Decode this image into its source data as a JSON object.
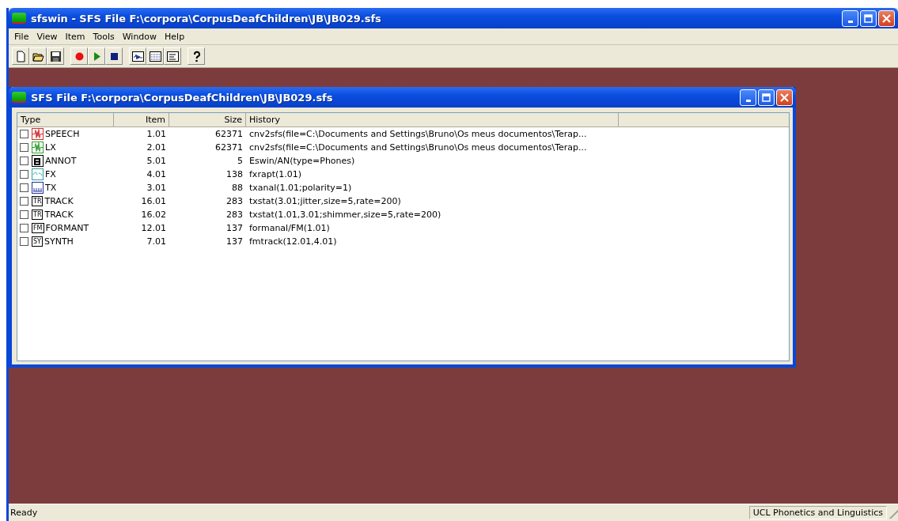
{
  "window": {
    "title": "sfswin - SFS File F:\\corpora\\CorpusDeafChildren\\JB\\JB029.sfs"
  },
  "menu": [
    "File",
    "View",
    "Item",
    "Tools",
    "Window",
    "Help"
  ],
  "toolbar": [
    {
      "kind": "new"
    },
    {
      "kind": "open"
    },
    {
      "kind": "save"
    },
    {
      "kind": "sep"
    },
    {
      "kind": "record"
    },
    {
      "kind": "play"
    },
    {
      "kind": "stop"
    },
    {
      "kind": "sep"
    },
    {
      "kind": "wave"
    },
    {
      "kind": "spectro"
    },
    {
      "kind": "text"
    },
    {
      "kind": "sep"
    },
    {
      "kind": "help"
    }
  ],
  "child_window": {
    "title": "SFS File F:\\corpora\\CorpusDeafChildren\\JB\\JB029.sfs",
    "columns": [
      "Type",
      "Item",
      "Size",
      "History"
    ],
    "rows": [
      {
        "checked": false,
        "kind": "speech",
        "type": "SPEECH",
        "item": "1.01",
        "size": "62371",
        "history": "cnv2sfs(file=C:\\Documents and Settings\\Bruno\\Os meus documentos\\Terap..."
      },
      {
        "checked": false,
        "kind": "lx",
        "type": "LX",
        "item": "2.01",
        "size": "62371",
        "history": "cnv2sfs(file=C:\\Documents and Settings\\Bruno\\Os meus documentos\\Terap..."
      },
      {
        "checked": false,
        "kind": "annot",
        "type": "ANNOT",
        "item": "5.01",
        "size": "5",
        "history": "Eswin/AN(type=Phones)"
      },
      {
        "checked": false,
        "kind": "fx",
        "type": "FX",
        "item": "4.01",
        "size": "138",
        "history": "fxrapt(1.01)"
      },
      {
        "checked": false,
        "kind": "tx",
        "type": "TX",
        "item": "3.01",
        "size": "88",
        "history": "txanal(1.01;polarity=1)"
      },
      {
        "checked": false,
        "kind": "badge",
        "badge": "TR",
        "type": "TRACK",
        "item": "16.01",
        "size": "283",
        "history": "txstat(3.01;jitter,size=5,rate=200)"
      },
      {
        "checked": false,
        "kind": "badge",
        "badge": "TR",
        "type": "TRACK",
        "item": "16.02",
        "size": "283",
        "history": "txstat(1.01,3.01;shimmer,size=5,rate=200)"
      },
      {
        "checked": false,
        "kind": "badge",
        "badge": "FM",
        "type": "FORMANT",
        "item": "12.01",
        "size": "137",
        "history": "formanal/FM(1.01)"
      },
      {
        "checked": false,
        "kind": "badge",
        "badge": "SY",
        "type": "SYNTH",
        "item": "7.01",
        "size": "137",
        "history": "fmtrack(12.01,4.01)"
      }
    ]
  },
  "status_bar": {
    "message": "Ready",
    "panel": "UCL Phonetics and Linguistics"
  }
}
